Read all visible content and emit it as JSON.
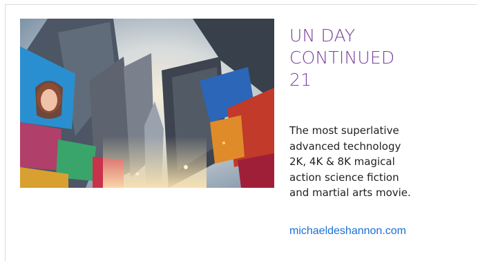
{
  "card": {
    "image_alt": "Times Square skyscrapers viewed from below",
    "title_lines": [
      "UN DAY",
      "CONTINUED",
      "21"
    ],
    "description_lines": [
      "The most superlative",
      "advanced technology",
      "2K, 4K & 8K magical",
      "action science fiction",
      "and martial arts movie."
    ],
    "link_text": "michaeldeshannon.com"
  },
  "colors": {
    "title": "#7a3f9c",
    "body_text": "#1f1f1f",
    "link": "#1a6fd6",
    "border": "#d9d9d9"
  }
}
